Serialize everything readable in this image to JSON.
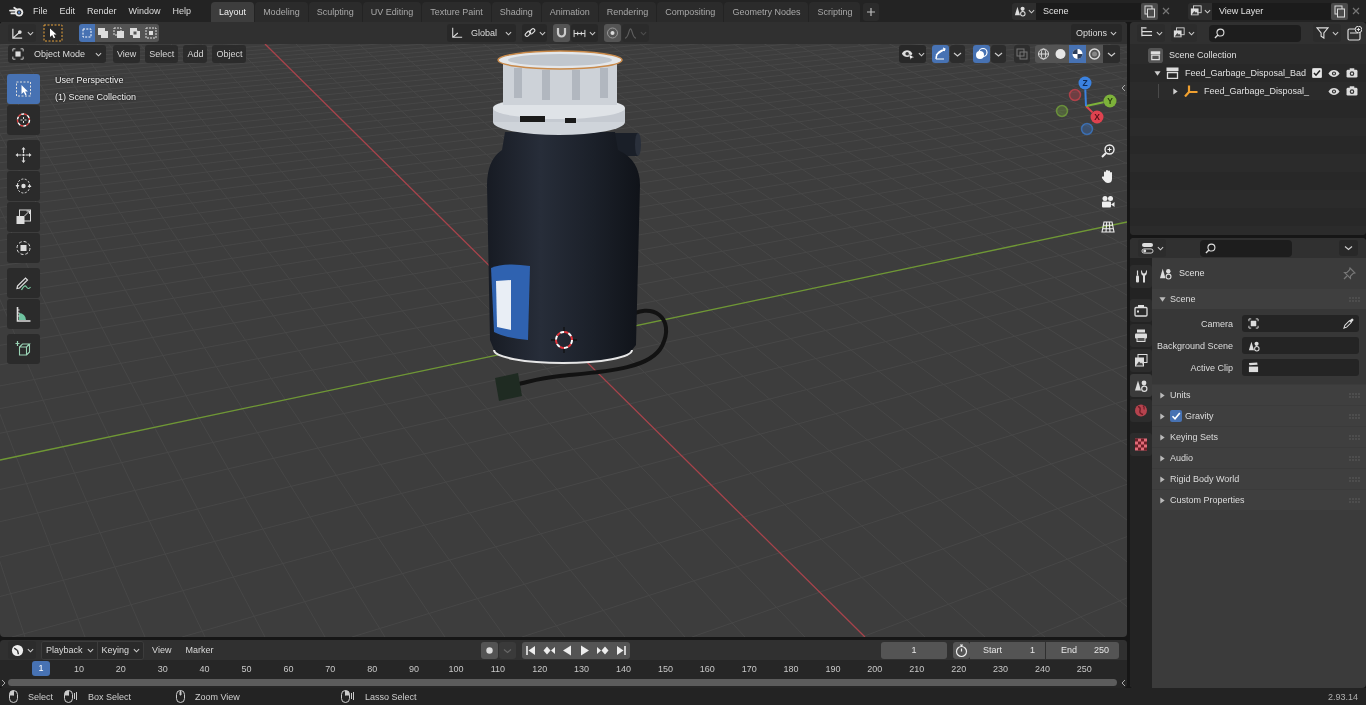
{
  "top_bar": {
    "menus": [
      "File",
      "Edit",
      "Render",
      "Window",
      "Help"
    ],
    "workspaces": [
      {
        "label": "Layout",
        "selected": true
      },
      {
        "label": "Modeling",
        "selected": false
      },
      {
        "label": "Sculpting",
        "selected": false
      },
      {
        "label": "UV Editing",
        "selected": false
      },
      {
        "label": "Texture Paint",
        "selected": false
      },
      {
        "label": "Shading",
        "selected": false
      },
      {
        "label": "Animation",
        "selected": false
      },
      {
        "label": "Rendering",
        "selected": false
      },
      {
        "label": "Compositing",
        "selected": false
      },
      {
        "label": "Geometry Nodes",
        "selected": false
      },
      {
        "label": "Scripting",
        "selected": false
      }
    ],
    "scene": "Scene",
    "view_layer": "View Layer"
  },
  "viewport_header": {
    "select_modes": [
      {
        "kind": "set",
        "selected": true
      },
      {
        "kind": "extend",
        "selected": false
      },
      {
        "kind": "subtract",
        "selected": false
      },
      {
        "kind": "invert",
        "selected": false
      },
      {
        "kind": "intersect",
        "selected": false
      }
    ],
    "orientation": "Global",
    "options": "Options",
    "mode": "Object Mode",
    "menus": [
      "View",
      "Select",
      "Add",
      "Object"
    ],
    "gizmos_on": true,
    "overlays_on": true,
    "xray_on": false,
    "shading": [
      {
        "kind": "wireframe",
        "selected": false
      },
      {
        "kind": "solid",
        "selected": false
      },
      {
        "kind": "material",
        "selected": true
      },
      {
        "kind": "rendered",
        "selected": false
      }
    ]
  },
  "viewport": {
    "view_name": "User Perspective",
    "collection_label": "(1) Scene Collection",
    "tool_groups": [
      [
        {
          "kind": "select_box",
          "selected": true
        },
        {
          "kind": "cursor",
          "selected": false
        }
      ],
      [
        {
          "kind": "move",
          "selected": false
        },
        {
          "kind": "rotate",
          "selected": false
        },
        {
          "kind": "scale",
          "selected": false
        },
        {
          "kind": "transform",
          "selected": false
        }
      ],
      [
        {
          "kind": "annotate",
          "selected": false
        },
        {
          "kind": "measure",
          "selected": false
        }
      ],
      [
        {
          "kind": "add_cube",
          "selected": false
        }
      ]
    ],
    "gizmo_axes": [
      "X",
      "Y",
      "Z"
    ]
  },
  "outliner": {
    "tree": [
      {
        "label": "Scene Collection",
        "kind": "scene_collection",
        "children": [
          {
            "label": "Feed_Garbage_Disposal_Bad",
            "kind": "collection",
            "expanded": true,
            "checked": true,
            "children": [
              {
                "label": "Feed_Garbage_Disposal_",
                "kind": "object",
                "expanded": false
              }
            ]
          }
        ]
      }
    ]
  },
  "properties": {
    "tab_groups": [
      [
        {
          "kind": "tool",
          "selected": false
        }
      ],
      [
        {
          "kind": "render",
          "selected": false
        },
        {
          "kind": "output",
          "selected": false
        },
        {
          "kind": "view_layer",
          "selected": false
        },
        {
          "kind": "scene",
          "selected": true
        },
        {
          "kind": "world",
          "selected": false
        }
      ],
      [
        {
          "kind": "texture",
          "selected": false
        }
      ]
    ],
    "context": "Scene",
    "panels": [
      {
        "title": "Scene",
        "expanded": true,
        "fields": [
          {
            "label": "Camera",
            "kind": "camera"
          },
          {
            "label": "Background Scene",
            "kind": "scene"
          },
          {
            "label": "Active Clip",
            "kind": "clip"
          }
        ]
      },
      {
        "title": "Units",
        "expanded": false
      },
      {
        "title": "Gravity",
        "expanded": false,
        "checked": true
      },
      {
        "title": "Keying Sets",
        "expanded": false
      },
      {
        "title": "Audio",
        "expanded": false
      },
      {
        "title": "Rigid Body World",
        "expanded": false
      },
      {
        "title": "Custom Properties",
        "expanded": false
      }
    ]
  },
  "timeline": {
    "dropdowns": [
      "Playback",
      "Keying"
    ],
    "menus": [
      "View",
      "Marker"
    ],
    "current_frame": "1",
    "start": {
      "label": "Start",
      "value": "1"
    },
    "end": {
      "label": "End",
      "value": "250"
    },
    "playhead": "1",
    "ticks": [
      "10",
      "20",
      "30",
      "40",
      "50",
      "60",
      "70",
      "80",
      "90",
      "100",
      "110",
      "120",
      "130",
      "140",
      "150",
      "160",
      "170",
      "180",
      "190",
      "200",
      "210",
      "220",
      "230",
      "240",
      "250"
    ]
  },
  "status_bar": {
    "hints": [
      {
        "kind": "left_click",
        "label": "Select"
      },
      {
        "kind": "left_drag",
        "label": "Box Select"
      },
      {
        "kind": "middle_click",
        "label": "Zoom View"
      },
      {
        "kind": "right_drag",
        "label": "Lasso Select"
      }
    ],
    "version": "2.93.14"
  }
}
